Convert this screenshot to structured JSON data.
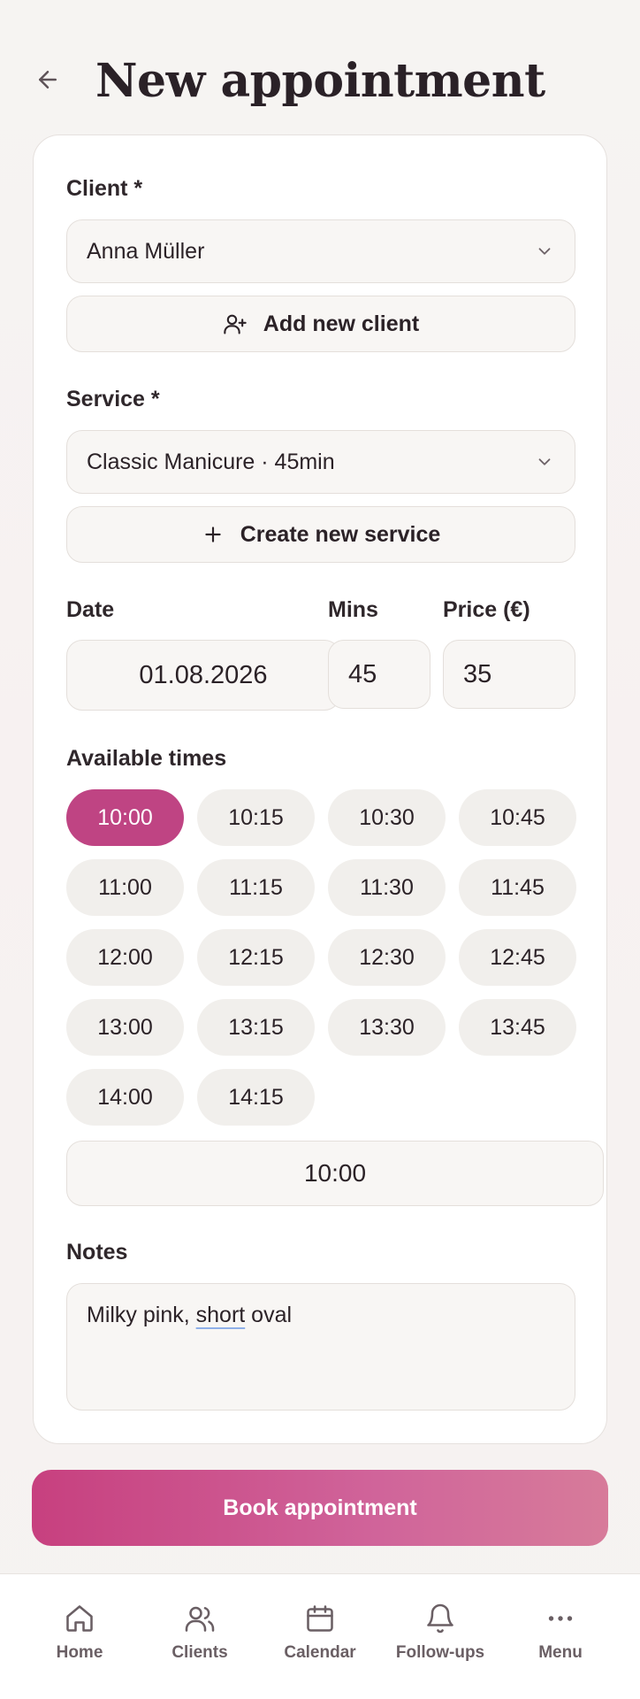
{
  "header": {
    "title": "New appointment",
    "back_icon": "arrow-left-icon"
  },
  "form": {
    "client": {
      "label": "Client *",
      "value": "Anna Müller",
      "add_label": "Add new client"
    },
    "service": {
      "label": "Service *",
      "value": "Classic Manicure · 45min",
      "create_label": "Create new service"
    },
    "date": {
      "label": "Date",
      "value": "01.08.2026"
    },
    "mins": {
      "label": "Mins",
      "value": "45"
    },
    "price": {
      "label": "Price (€)",
      "value": "35"
    },
    "times": {
      "label": "Available times",
      "slots": [
        "10:00",
        "10:15",
        "10:30",
        "10:45",
        "11:00",
        "11:15",
        "11:30",
        "11:45",
        "12:00",
        "12:15",
        "12:30",
        "12:45",
        "13:00",
        "13:15",
        "13:30",
        "13:45",
        "14:00",
        "14:15"
      ],
      "selected": "10:00"
    },
    "selected_time": "10:00",
    "notes": {
      "label": "Notes",
      "pre": "Milky pink, ",
      "underlined": "short",
      "post": " oval"
    }
  },
  "book_label": "Book appointment",
  "tabs": [
    {
      "label": "Home",
      "icon": "home-icon"
    },
    {
      "label": "Clients",
      "icon": "users-icon"
    },
    {
      "label": "Calendar",
      "icon": "calendar-icon"
    },
    {
      "label": "Follow-ups",
      "icon": "bell-icon"
    },
    {
      "label": "Menu",
      "icon": "more-icon"
    }
  ],
  "colors": {
    "accent": "#bf4483",
    "chip": "#f1efec",
    "field_bg": "#f8f6f4"
  }
}
